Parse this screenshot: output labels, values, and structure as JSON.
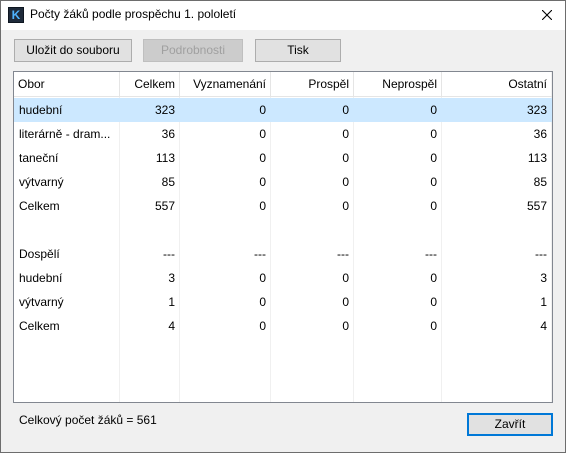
{
  "window": {
    "title": "Počty žáků podle prospěchu 1. pololetí",
    "icon_letter": "K"
  },
  "toolbar": {
    "save_label": "Uložit do souboru",
    "details_label": "Podrobnosti",
    "print_label": "Tisk"
  },
  "table": {
    "columns": [
      "Obor",
      "Celkem",
      "Vyznamenání",
      "Prospěl",
      "Neprospěl",
      "Ostatní"
    ],
    "rows": [
      [
        "hudební",
        "323",
        "0",
        "0",
        "0",
        "323"
      ],
      [
        "literárně - dram...",
        "36",
        "0",
        "0",
        "0",
        "36"
      ],
      [
        "taneční",
        "113",
        "0",
        "0",
        "0",
        "113"
      ],
      [
        "výtvarný",
        "85",
        "0",
        "0",
        "0",
        "85"
      ],
      [
        "Celkem",
        "557",
        "0",
        "0",
        "0",
        "557"
      ],
      [
        "",
        "",
        "",
        "",
        "",
        ""
      ],
      [
        "Dospělí",
        "---",
        "---",
        "---",
        "---",
        "---"
      ],
      [
        "hudební",
        "3",
        "0",
        "0",
        "0",
        "3"
      ],
      [
        "výtvarný",
        "1",
        "0",
        "0",
        "0",
        "1"
      ],
      [
        "Celkem",
        "4",
        "0",
        "0",
        "0",
        "4"
      ]
    ]
  },
  "footer": {
    "total_text": "Celkový počet žáků = 561",
    "close_label": "Zavřít"
  }
}
